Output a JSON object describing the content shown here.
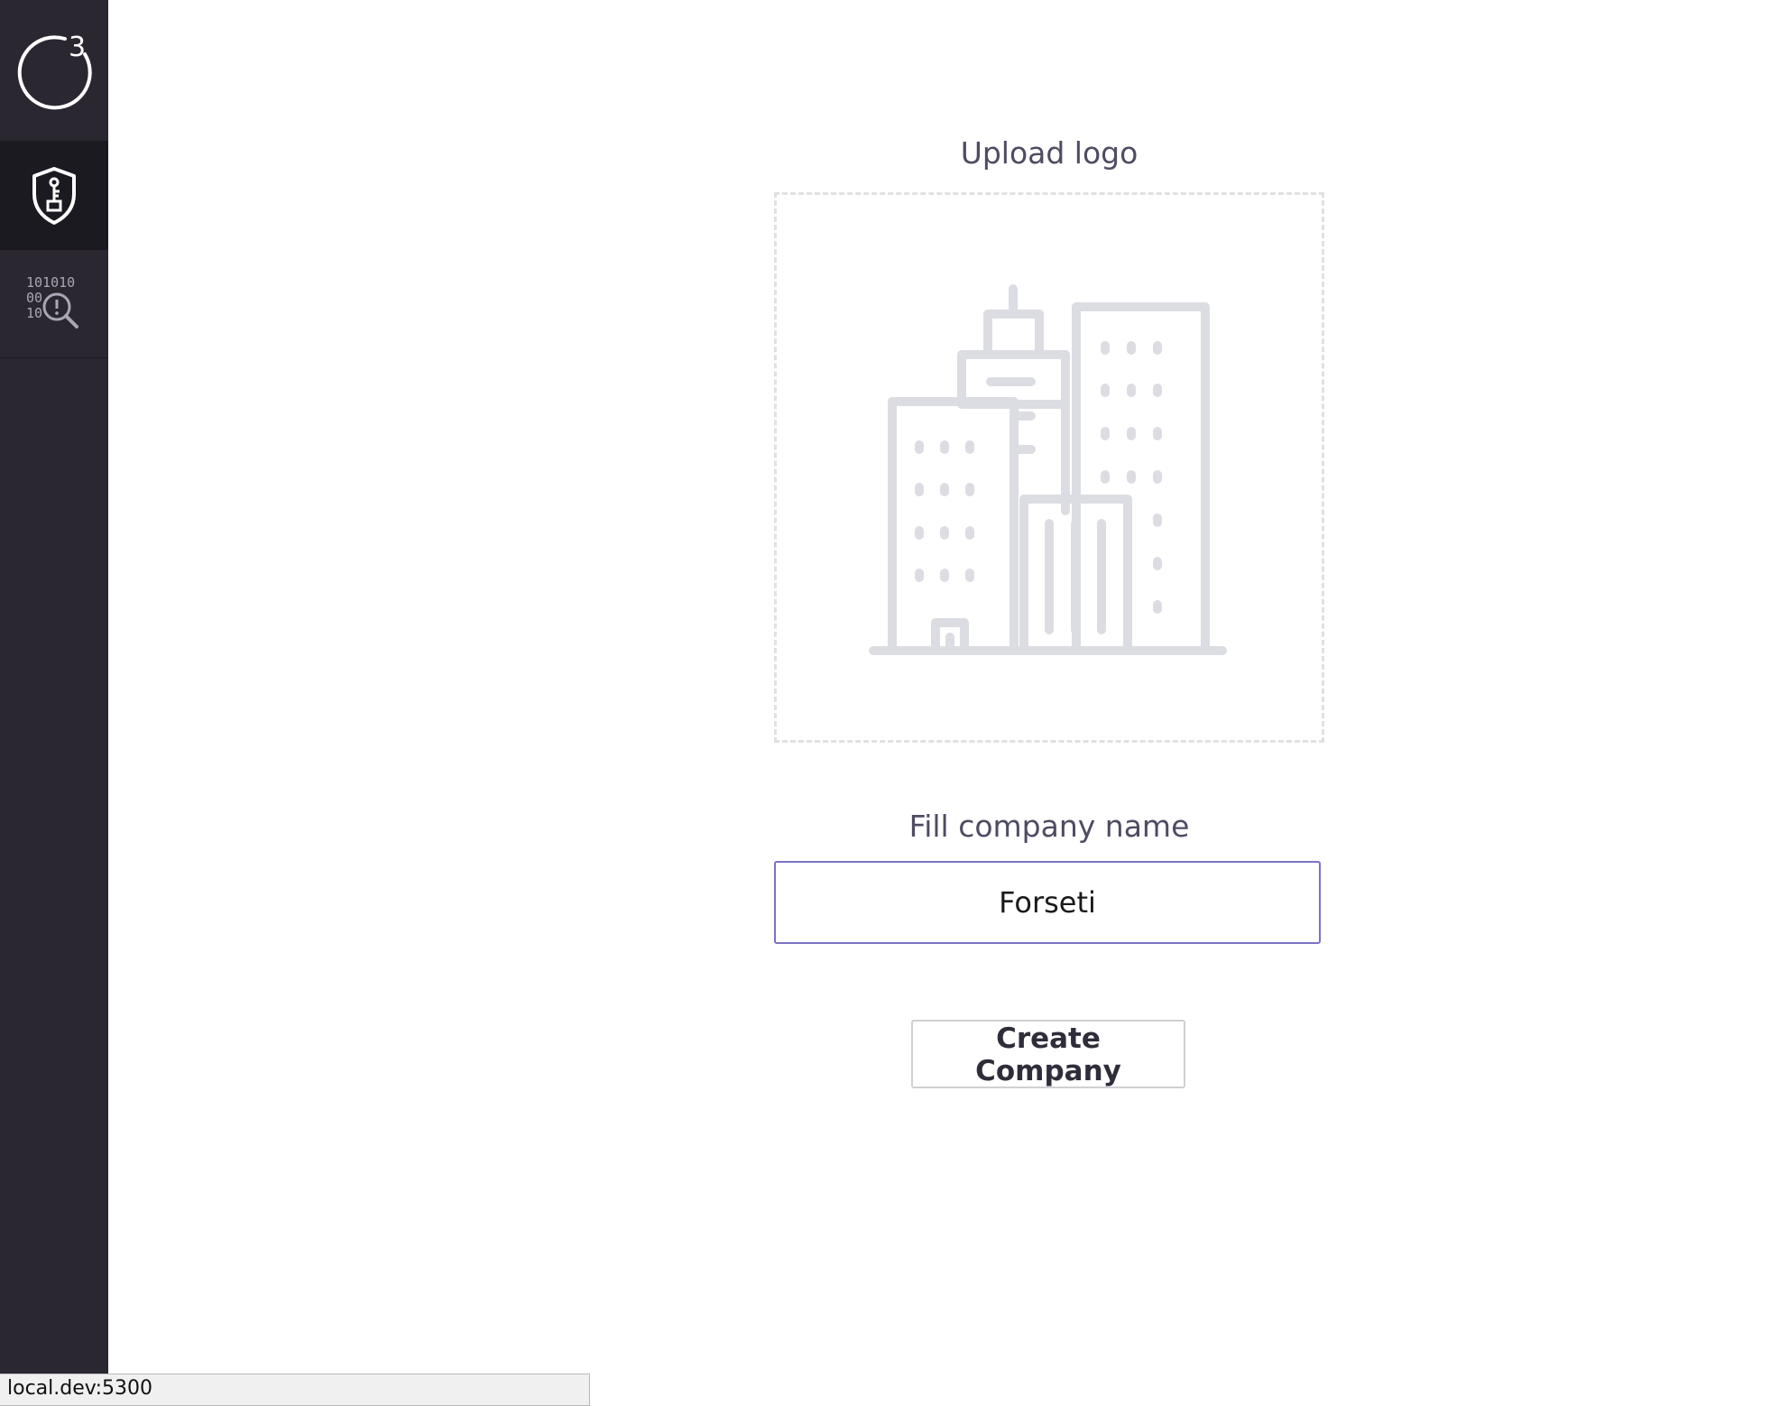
{
  "sidebar": {
    "logo_icon": "c3-logo-icon",
    "items": [
      {
        "name": "key-shield-icon",
        "active": true
      },
      {
        "name": "binary-search-alert-icon",
        "active": false
      }
    ],
    "background": "#2a2731",
    "active_background": "#1c1a21"
  },
  "upload": {
    "label": "Upload logo",
    "placeholder_icon": "buildings-icon"
  },
  "company": {
    "label": "Fill company name",
    "value": "Forseti"
  },
  "actions": {
    "create_label": "Create Company"
  },
  "status_bar": {
    "url": "local.dev:5300"
  },
  "colors": {
    "accent": "#7b72c6",
    "label_text": "#4f4b63",
    "placeholder_icon": "#dcdde3"
  }
}
